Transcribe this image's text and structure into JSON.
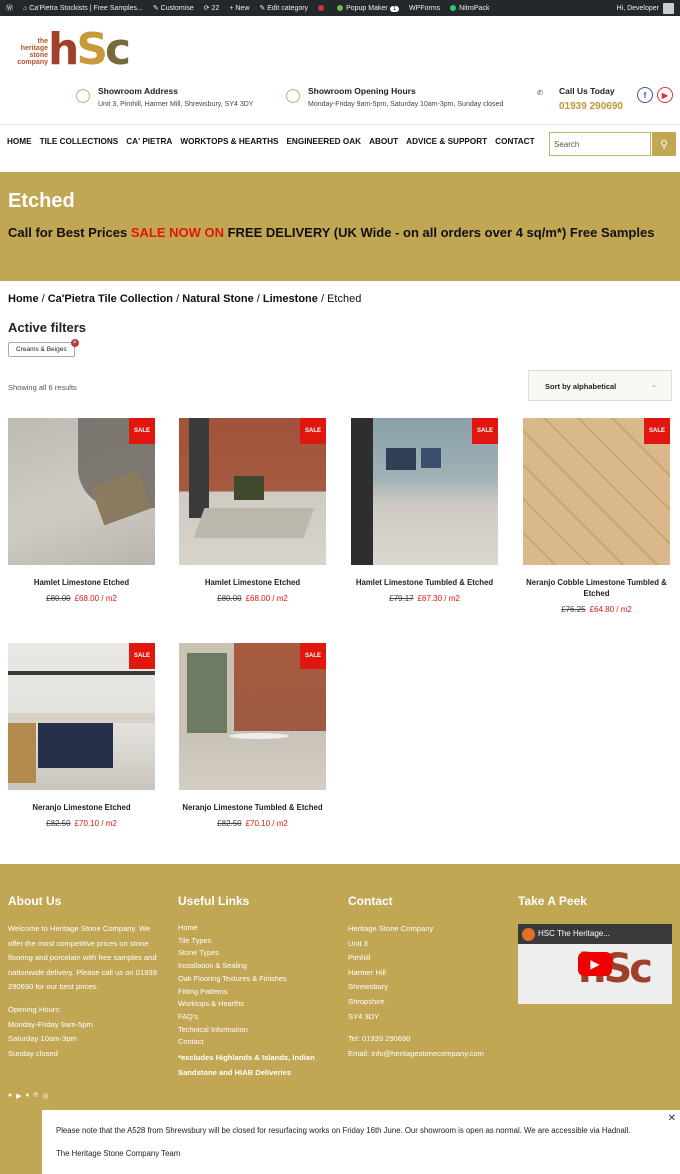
{
  "admin_bar": {
    "site": "Ca'Pietra Stockists | Free Samples...",
    "customise": "Customise",
    "updates": "22",
    "new": "New",
    "edit": "Edit category",
    "popup": "Popup Maker",
    "popup_count": "1",
    "wpforms": "WPForms",
    "nitro": "NitroPack",
    "greeting": "Hi, Developer"
  },
  "logo": {
    "small_lines": "the heritage stone company",
    "big": "hSc"
  },
  "info": {
    "address_title": "Showroom Address",
    "address": "Unit 3, Pimhill, Harmer Mill, Shrewsbury, SY4 3DY",
    "hours_title": "Showroom Opening Hours",
    "hours": "Monday-Friday 9am-5pm, Saturday 10am-3pm, Sunday closed",
    "call_title": "Call Us Today",
    "phone": "01939 290690"
  },
  "nav": [
    "HOME",
    "TILE COLLECTIONS",
    "CA' PIETRA",
    "WORKTOPS & HEARTHS",
    "ENGINEERED OAK",
    "ABOUT",
    "ADVICE & SUPPORT",
    "CONTACT"
  ],
  "search": {
    "placeholder": "Search"
  },
  "banner": {
    "title": "Etched",
    "pre": "Call for Best Prices ",
    "sale": "SALE NOW ON",
    "post": " FREE DELIVERY (UK Wide - on all orders over 4 sq/m*) Free Samples"
  },
  "breadcrumb": {
    "home": "Home",
    "sep": " / ",
    "c1": "Ca'Pietra Tile Collection",
    "c2": "Natural Stone",
    "c3": "Limestone",
    "current": "Etched"
  },
  "filters": {
    "title": "Active filters",
    "chip": "Creams & Beiges"
  },
  "results": "Showing all 6 results",
  "sort": "Sort by alphabetical",
  "sale_badge": "SALE",
  "products": [
    {
      "name": "Hamlet Limestone Etched",
      "old": "£80.00",
      "new": "£68.00 / m2"
    },
    {
      "name": "Hamlet Limestone Etched",
      "old": "£80.00",
      "new": "£68.00 / m2"
    },
    {
      "name": "Hamlet Limestone Tumbled & Etched",
      "old": "£79.17",
      "new": "£67.30 / m2"
    },
    {
      "name": "Neranjo Cobble Limestone Tumbled & Etched",
      "old": "£76.25",
      "new": "£64.80 / m2"
    },
    {
      "name": "Neranjo Limestone Etched",
      "old": "£82.50",
      "new": "£70.10 / m2"
    },
    {
      "name": "Neranjo Limestone Tumbled & Etched",
      "old": "£82.50",
      "new": "£70.10 / m2"
    }
  ],
  "footer": {
    "about_title": "About Us",
    "about_text": "Welcome to Heritage Stone Company. We offer the most competitive prices on stone flooring and porcelain with free samples and nationwide delivery.  Please call us on 01939 290690 for our best prices.",
    "opening_title": "Opening Hours:",
    "opening": [
      "Monday-Friday 9am-5pm",
      "Saturday 10am-3pm",
      "Sunday closed"
    ],
    "links_title": "Useful Links",
    "links": [
      "Home",
      "Tile Types",
      "Stone Types",
      "Installation & Sealing",
      "Oak Flooring Textures & Finishes",
      "Fitting Patterns",
      "Worktops & Hearths",
      "FAQ's",
      "Technical Information",
      "Contact"
    ],
    "links_note": "*excludes Highlands & Islands, Indian Sandstone and HIAB Deliveries",
    "contact_title": "Contact",
    "contact": [
      "Heritage Stone Company",
      "Unit 3",
      "Pimhill",
      "Harmer Hill",
      "Shrewsbury",
      "Shropshire",
      "SY4 3DY"
    ],
    "tel": "Tel: 01939 290690",
    "email": "Email: info@heritagestonecompany.com",
    "peek_title": "Take A Peek",
    "video_title": "HSC The Heritage..."
  },
  "notice": {
    "line1": "Please note that the A528 from Shrewsbury will be closed for resurfacing works on Friday 16th June.  Our showroom is open as normal.  We are accessible via Hadnall.",
    "line2": "The Heritage Stone Company Team"
  },
  "colors": {
    "gold": "#c1a654",
    "sale_red": "#e0160f",
    "admin_bg": "#23282d"
  }
}
